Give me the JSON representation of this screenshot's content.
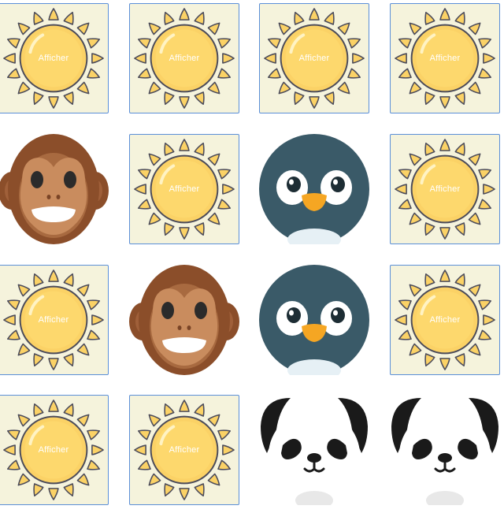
{
  "board": {
    "hidden_label": "Afficher",
    "cards": [
      {
        "state": "hidden",
        "icon": "sun-icon"
      },
      {
        "state": "hidden",
        "icon": "sun-icon"
      },
      {
        "state": "hidden",
        "icon": "sun-icon"
      },
      {
        "state": "hidden",
        "icon": "sun-icon"
      },
      {
        "state": "revealed",
        "icon": "monkey-icon"
      },
      {
        "state": "hidden",
        "icon": "sun-icon"
      },
      {
        "state": "revealed",
        "icon": "penguin-icon"
      },
      {
        "state": "hidden",
        "icon": "sun-icon"
      },
      {
        "state": "hidden",
        "icon": "sun-icon"
      },
      {
        "state": "revealed",
        "icon": "monkey-icon"
      },
      {
        "state": "revealed",
        "icon": "penguin-icon"
      },
      {
        "state": "hidden",
        "icon": "sun-icon"
      },
      {
        "state": "hidden",
        "icon": "sun-icon"
      },
      {
        "state": "hidden",
        "icon": "sun-icon"
      },
      {
        "state": "revealed",
        "icon": "panda-icon"
      },
      {
        "state": "revealed",
        "icon": "panda-icon"
      }
    ]
  },
  "colors": {
    "card_back": "#f5f3dc",
    "card_border": "#5a8fd8",
    "sun_body": "#fbd266",
    "sun_outline": "#4b4b5a",
    "monkey_fur": "#8b4e2a",
    "monkey_face": "#c98c5e",
    "penguin_body": "#3a5a68",
    "penguin_beak": "#f5a623",
    "panda_ear": "#1a1a1a"
  }
}
